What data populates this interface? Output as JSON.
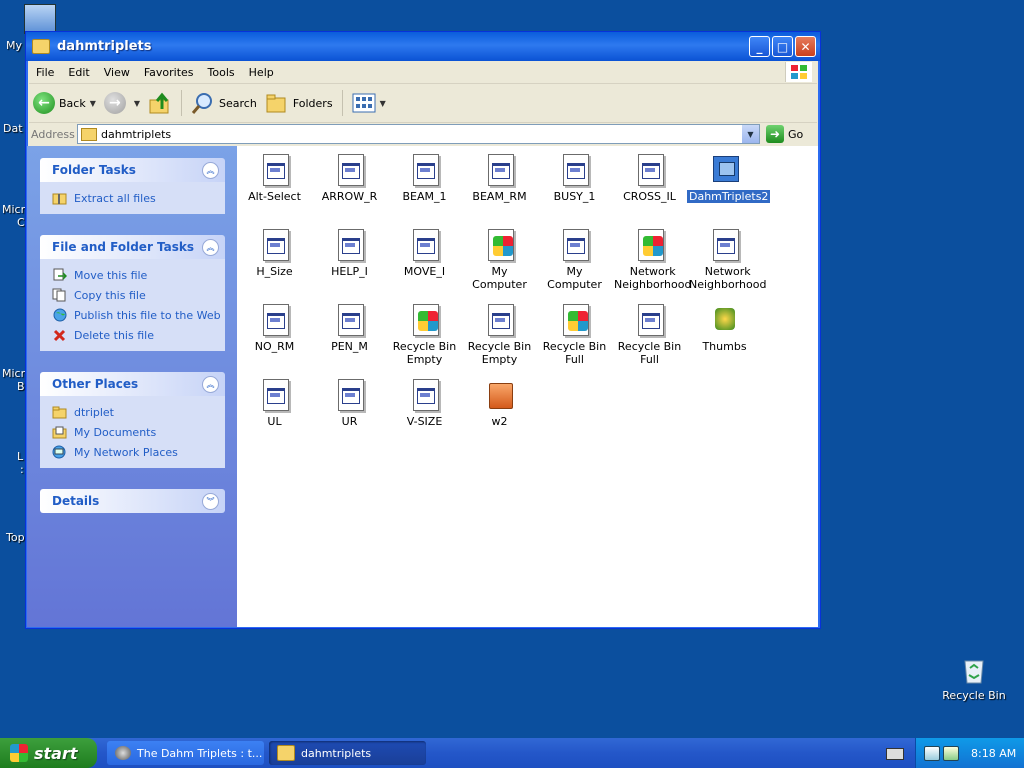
{
  "desktop": {
    "labels": [
      "My",
      "Dat",
      "Micr",
      "C",
      "Micr",
      "B",
      "L",
      ":",
      "Top"
    ],
    "recycle_bin": "Recycle Bin"
  },
  "window": {
    "title": "dahmtriplets",
    "controls": {
      "minimize": "_",
      "maximize": "□",
      "close": "✕"
    }
  },
  "menu": [
    "File",
    "Edit",
    "View",
    "Favorites",
    "Tools",
    "Help"
  ],
  "toolbar": {
    "back": "Back",
    "search": "Search",
    "folders": "Folders"
  },
  "address": {
    "label": "Address",
    "value": "dahmtriplets",
    "go": "Go"
  },
  "sidebar": {
    "folder_tasks": {
      "title": "Folder Tasks",
      "items": [
        "Extract all files"
      ]
    },
    "file_folder_tasks": {
      "title": "File and Folder Tasks",
      "items": [
        "Move this file",
        "Copy this file",
        "Publish this file to the Web",
        "Delete this file"
      ]
    },
    "other_places": {
      "title": "Other Places",
      "items": [
        "dtriplet",
        "My Documents",
        "My Network Places"
      ]
    },
    "details": {
      "title": "Details"
    }
  },
  "files": [
    {
      "name": "Alt-Select",
      "icon": "cursor-file-icon"
    },
    {
      "name": "ARROW_R",
      "icon": "cursor-file-icon"
    },
    {
      "name": "BEAM_1",
      "icon": "cursor-file-icon"
    },
    {
      "name": "BEAM_RM",
      "icon": "cursor-file-icon"
    },
    {
      "name": "BUSY_1",
      "icon": "cursor-file-icon"
    },
    {
      "name": "CROSS_IL",
      "icon": "cursor-file-icon"
    },
    {
      "name": "DahmTriplets2",
      "icon": "image-file-icon",
      "selected": true
    },
    {
      "name": "H_Size",
      "icon": "cursor-file-icon"
    },
    {
      "name": "HELP_I",
      "icon": "cursor-file-icon"
    },
    {
      "name": "MOVE_I",
      "icon": "cursor-file-icon"
    },
    {
      "name": "My Computer",
      "icon": "colorful-icon-file-icon"
    },
    {
      "name": "My Computer",
      "icon": "cursor-file-icon"
    },
    {
      "name": "Network Neighborhood",
      "icon": "colorful-icon-file-icon"
    },
    {
      "name": "Network Neighborhood",
      "icon": "cursor-file-icon"
    },
    {
      "name": "NO_RM",
      "icon": "cursor-file-icon"
    },
    {
      "name": "PEN_M",
      "icon": "cursor-file-icon"
    },
    {
      "name": "Recycle Bin Empty",
      "icon": "colorful-icon-file-icon"
    },
    {
      "name": "Recycle Bin Empty",
      "icon": "cursor-file-icon"
    },
    {
      "name": "Recycle Bin Full",
      "icon": "colorful-icon-file-icon"
    },
    {
      "name": "Recycle Bin Full",
      "icon": "cursor-file-icon"
    },
    {
      "name": "Thumbs",
      "icon": "thumbs-db-icon"
    },
    {
      "name": "UL",
      "icon": "cursor-file-icon"
    },
    {
      "name": "UR",
      "icon": "cursor-file-icon"
    },
    {
      "name": "V-SIZE",
      "icon": "cursor-file-icon"
    },
    {
      "name": "w2",
      "icon": "archive-file-icon"
    }
  ],
  "taskbar": {
    "start": "start",
    "tasks": [
      "The Dahm Triplets : t...",
      "dahmtriplets"
    ],
    "clock": "8:18 AM"
  },
  "colors": {
    "desktop": "#0b4f9e",
    "title": "#0a5ddc",
    "link": "#215dc6",
    "selection": "#316ac5"
  }
}
